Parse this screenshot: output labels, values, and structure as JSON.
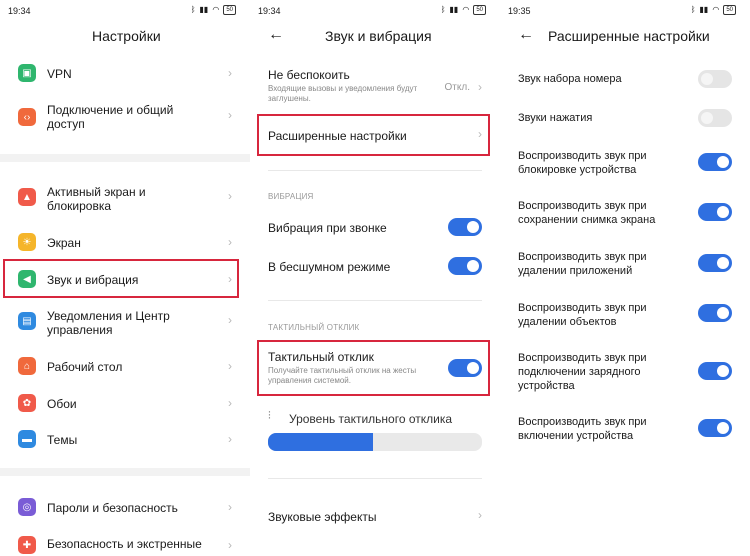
{
  "status": {
    "s1_time": "19:34",
    "s2_time": "19:34",
    "s3_time": "19:35",
    "battery": "50"
  },
  "screen1": {
    "title": "Настройки",
    "items": [
      {
        "label": "VPN",
        "icon": "vpn-icon",
        "color": "#2fb66e"
      },
      {
        "label": "Подключение и общий доступ",
        "icon": "connection-icon",
        "color": "#f0693c"
      },
      {
        "label": "Активный экран и блокировка",
        "icon": "lock-icon",
        "color": "#f05a4a"
      },
      {
        "label": "Экран",
        "icon": "sun-icon",
        "color": "#f5b52a"
      },
      {
        "label": "Звук и вибрация",
        "icon": "speaker-icon",
        "color": "#2fb66e"
      },
      {
        "label": "Уведомления и Центр управления",
        "icon": "notification-icon",
        "color": "#2f8ae0"
      },
      {
        "label": "Рабочий стол",
        "icon": "home-icon",
        "color": "#f0693c"
      },
      {
        "label": "Обои",
        "icon": "wallpaper-icon",
        "color": "#f05a4a"
      },
      {
        "label": "Темы",
        "icon": "theme-icon",
        "color": "#2f8ae0"
      },
      {
        "label": "Пароли и безопасность",
        "icon": "fingerprint-icon",
        "color": "#7a5cd6"
      },
      {
        "label": "Безопасность и экстренные",
        "icon": "emergency-icon",
        "color": "#f05a4a"
      }
    ]
  },
  "screen2": {
    "title": "Звук и вибрация",
    "dnd_title": "Не беспокоить",
    "dnd_sub": "Входящие вызовы и уведомления будут заглушены.",
    "dnd_value": "Откл.",
    "advanced": "Расширенные настройки",
    "vibration_section": "ВИБРАЦИЯ",
    "vibrate_ring": "Вибрация при звонке",
    "vibrate_silent": "В бесшумном режиме",
    "haptic_section": "ТАКТИЛЬНЫЙ ОТКЛИК",
    "haptic_title": "Тактильный отклик",
    "haptic_sub": "Получайте тактильный отклик на жесты управления системой.",
    "haptic_level_label": "Уровень тактильного отклика",
    "haptic_level_fraction": 0.49,
    "sound_effects": "Звуковые эффекты",
    "toggles": {
      "vibrate_ring": true,
      "vibrate_silent": true,
      "haptic": true
    }
  },
  "screen3": {
    "title": "Расширенные настройки",
    "items": [
      {
        "label": "Звук набора номера",
        "on": false
      },
      {
        "label": "Звуки нажатия",
        "on": false
      },
      {
        "label": "Воспроизводить звук при блокировке устройства",
        "on": true
      },
      {
        "label": "Воспроизводить звук при сохранении снимка экрана",
        "on": true
      },
      {
        "label": "Воспроизводить звук при удалении приложений",
        "on": true
      },
      {
        "label": "Воспроизводить звук при удалении объектов",
        "on": true
      },
      {
        "label": "Воспроизводить звук при подключении зарядного устройства",
        "on": true
      },
      {
        "label": "Воспроизводить звук при включении устройства",
        "on": true
      }
    ]
  },
  "colors": {
    "accent": "#2f6fe0",
    "highlight": "#d7263d"
  }
}
